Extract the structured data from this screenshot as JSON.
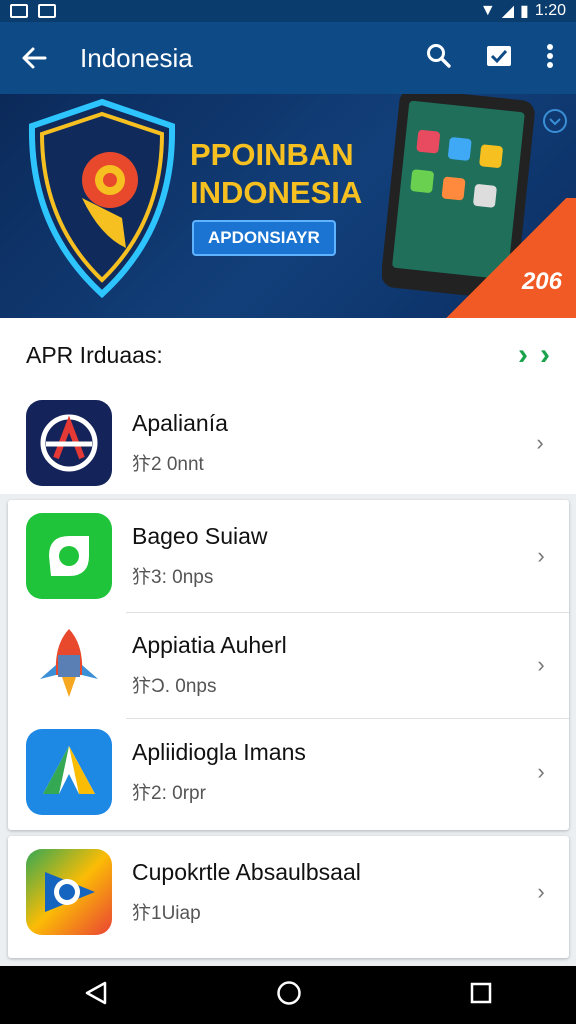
{
  "status_bar": {
    "time": "1:20"
  },
  "app_bar": {
    "title": "Indonesia"
  },
  "banner": {
    "headline_line1": "PPOINBAN",
    "headline_line2": "INDONESIA",
    "button_label": "APDONSIAYR",
    "year": "206"
  },
  "section": {
    "title": "APR Irduaas:"
  },
  "apps": [
    {
      "name": "Apalianía",
      "meta": "犿2 0nnt"
    },
    {
      "name": "Bageo Suiaw",
      "meta": "犿3: 0nps"
    },
    {
      "name": "Appiatia Auherl",
      "meta": "犿Ɔ. 0nps"
    },
    {
      "name": "Apliidiogla Imans",
      "meta": "犿2: 0rpr"
    },
    {
      "name": "Cupokrtle Absaulbsaal",
      "meta": "犿1Uiap"
    }
  ],
  "colors": {
    "app_bar": "#0e4b86",
    "status_bar": "#0b3c6e",
    "accent_green": "#1aa34a"
  }
}
